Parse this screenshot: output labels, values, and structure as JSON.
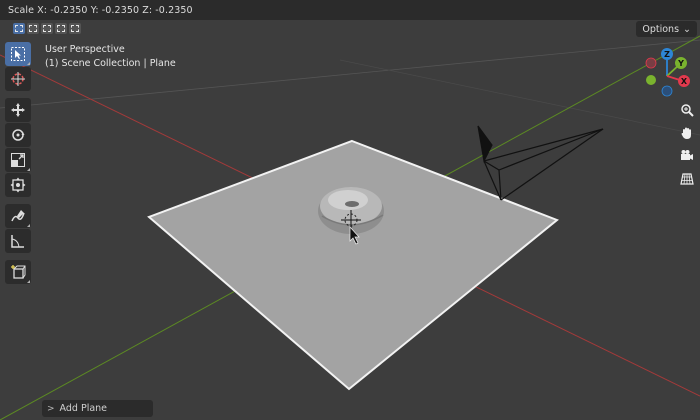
{
  "header": {
    "scale_readout": "Scale X: -0.2350   Y: -0.2350  Z: -0.2350"
  },
  "viewport": {
    "perspective_label": "User Perspective",
    "collection_label": "(1) Scene Collection | Plane",
    "options_label": "Options",
    "options_chevron": "⌄"
  },
  "toolbar": {
    "tools": [
      "select-box",
      "cursor",
      "move",
      "rotate",
      "scale",
      "transform",
      "annotate",
      "measure",
      "add-cube"
    ],
    "active_tool": "select-box"
  },
  "select_modes": [
    "set",
    "extend",
    "subtract",
    "invert",
    "intersect"
  ],
  "gizmo": {
    "x_label": "X",
    "y_label": "Y",
    "z_label": "Z",
    "x_color": "#e2394d",
    "y_color": "#7ab32e",
    "z_color": "#2d86d6"
  },
  "nav_buttons": [
    "zoom-icon",
    "hand-pan-icon",
    "camera-icon",
    "grid-ortho-icon"
  ],
  "last_operator": {
    "chevron": ">",
    "label": "Add Plane"
  },
  "colors": {
    "background": "#3d3d3d",
    "plane_fill": "#a3a3a3",
    "selection_outline": "#f2f2f2",
    "x_axis": "#a33a3a",
    "y_axis": "#5c8a23",
    "active_tool": "#4a6fa5"
  }
}
